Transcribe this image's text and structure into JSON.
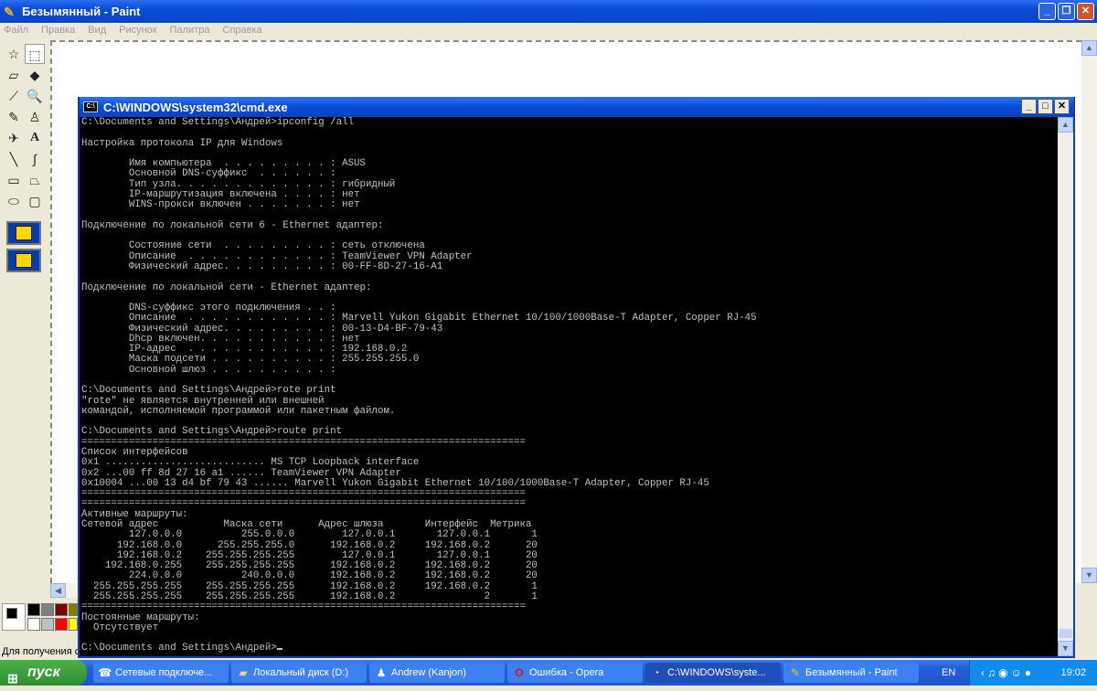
{
  "paint": {
    "title": "Безымянный - Paint",
    "menu": [
      "Файл",
      "Правка",
      "Вид",
      "Рисунок",
      "Палитра",
      "Справка"
    ],
    "status": "Для получения справки",
    "palette_colors": [
      "#000000",
      "#808080",
      "#800000",
      "#808000",
      "#ffffff",
      "#c0c0c0",
      "#ff0000",
      "#ffff00"
    ]
  },
  "cmd": {
    "title": "C:\\WINDOWS\\system32\\cmd.exe",
    "lines": [
      "C:\\Documents and Settings\\Андрей>ipconfig /all",
      "",
      "Настройка протокола IP для Windows",
      "",
      "        Имя компьютера  . . . . . . . . . : ASUS",
      "        Основной DNS-суффикс  . . . . . . :",
      "        Тип узла. . . . . . . . . . . . . : гибридный",
      "        IP-маршрутизация включена . . . . : нет",
      "        WINS-прокси включен . . . . . . . : нет",
      "",
      "Подключение по локальной сети 6 - Ethernet адаптер:",
      "",
      "        Состояние сети  . . . . . . . . . : сеть отключена",
      "        Описание  . . . . . . . . . . . . : TeamViewer VPN Adapter",
      "        Физический адрес. . . . . . . . . : 00-FF-8D-27-16-A1",
      "",
      "Подключение по локальной сети - Ethernet адаптер:",
      "",
      "        DNS-суффикс этого подключения . . :",
      "        Описание  . . . . . . . . . . . . : Marvell Yukon Gigabit Ethernet 10/100/1000Base-T Adapter, Copper RJ-45",
      "        Физический адрес. . . . . . . . . : 00-13-D4-BF-79-43",
      "        Dhcp включен. . . . . . . . . . . : нет",
      "        IP-адрес  . . . . . . . . . . . . : 192.168.0.2",
      "        Маска подсети . . . . . . . . . . : 255.255.255.0",
      "        Основной шлюз . . . . . . . . . . :",
      "",
      "C:\\Documents and Settings\\Андрей>rote print",
      "\"rote\" не является внутренней или внешней",
      "командой, исполняемой программой или пакетным файлом.",
      "",
      "C:\\Documents and Settings\\Андрей>route print",
      "===========================================================================",
      "Список интерфейсов",
      "0x1 ........................... MS TCP Loopback interface",
      "0x2 ...00 ff 8d 27 16 a1 ...... TeamViewer VPN Adapter",
      "0x10004 ...00 13 d4 bf 79 43 ...... Marvell Yukon Gigabit Ethernet 10/100/1000Base-T Adapter, Copper RJ-45",
      "===========================================================================",
      "===========================================================================",
      "Активные маршруты:",
      "Сетевой адрес           Маска сети      Адрес шлюза       Интерфейс  Метрика",
      "        127.0.0.0          255.0.0.0        127.0.0.1       127.0.0.1       1",
      "      192.168.0.0      255.255.255.0      192.168.0.2     192.168.0.2      20",
      "      192.168.0.2    255.255.255.255        127.0.0.1       127.0.0.1      20",
      "    192.168.0.255    255.255.255.255      192.168.0.2     192.168.0.2      20",
      "        224.0.0.0          240.0.0.0      192.168.0.2     192.168.0.2      20",
      "  255.255.255.255    255.255.255.255      192.168.0.2     192.168.0.2       1",
      "  255.255.255.255    255.255.255.255      192.168.0.2               2       1",
      "===========================================================================",
      "Постоянные маршруты:",
      "  Отсутствует",
      "",
      "C:\\Documents and Settings\\Андрей>"
    ]
  },
  "taskbar": {
    "start": "пуск",
    "tasks": [
      {
        "label": "Сетевые подключе...",
        "icon": "network-icon"
      },
      {
        "label": "Локальный диск (D:)",
        "icon": "folder-icon"
      },
      {
        "label": "Andrew (Kanjon)",
        "icon": "chat-icon"
      },
      {
        "label": "Ошибка - Opera",
        "icon": "opera-icon"
      },
      {
        "label": "C:\\WINDOWS\\syste...",
        "icon": "cmd-icon"
      },
      {
        "label": "Безымянный - Paint",
        "icon": "paint-icon"
      }
    ],
    "lang": "EN",
    "clock": "19:02"
  }
}
